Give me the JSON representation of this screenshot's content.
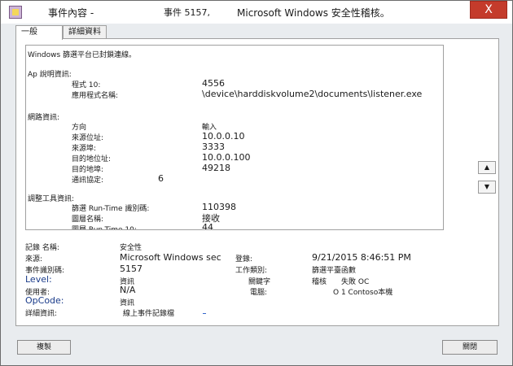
{
  "title": {
    "left": "事件內容 -",
    "middle": "事件 5157,",
    "right": "Microsoft Windows 安全性稽核。",
    "close": "X"
  },
  "tabs": [
    {
      "label": "一般"
    },
    {
      "label": "詳細資料"
    }
  ],
  "description": {
    "intro": "Windows 篩選平台已封鎖連線。",
    "app_header": "Ap 說明資訊:",
    "app_rows": [
      {
        "label": "程式 10:",
        "value": "4556"
      },
      {
        "label": "應用程式名稱:",
        "value": "\\device\\harddiskvolume2\\documents\\listener.exe"
      }
    ],
    "net_header": "網路資訊:",
    "net_rows": [
      {
        "label": "方向",
        "value": "輸入"
      },
      {
        "label": "來源位址:",
        "value": "10.0.0.10"
      },
      {
        "label": "來源埠:",
        "value": "3333"
      },
      {
        "label": "目的地位址:",
        "value": "10.0.0.100"
      },
      {
        "label": "目的地埠:",
        "value": "49218"
      },
      {
        "label": "通訊協定:",
        "value": "6"
      }
    ],
    "filter_header": "調整工具資訊:",
    "filter_rows": [
      {
        "label": "篩選 Run-Time 識別碼:",
        "value": "110398"
      },
      {
        "label": "圖層名稱:",
        "value": "接收"
      },
      {
        "label": "圖層 Run-Time 10:",
        "value": "44"
      }
    ]
  },
  "fields": {
    "log_name_label": "記錄 名稱:",
    "log_name_value": "安全性",
    "source_label": "來源:",
    "source_value": "Microsoft Windows sec",
    "logged_label": "登錄:",
    "logged_value": "9/21/2015 8:46:51 PM",
    "event_id_label": "事件識別碼:",
    "event_id_value": "5157",
    "task_label": "工作類別:",
    "task_value": "篩選平臺函數",
    "level_label": "Level:",
    "level_value": "資訊",
    "keywords_label": "關鍵字",
    "keywords_v1": "稽核",
    "keywords_v2": "失敗 OC",
    "user_label": "使用者:",
    "user_value": "N/A",
    "computer_label": "電腦:",
    "computer_value": "O 1 Contoso本機",
    "opcode_label": "OpCode:",
    "opcode_value": "資訊",
    "more_label": "詳細資訊:",
    "more_value": "線上事件記錄檔"
  },
  "buttons": {
    "copy": "複製",
    "close": "關閉",
    "up": "▲",
    "down": "▼"
  }
}
